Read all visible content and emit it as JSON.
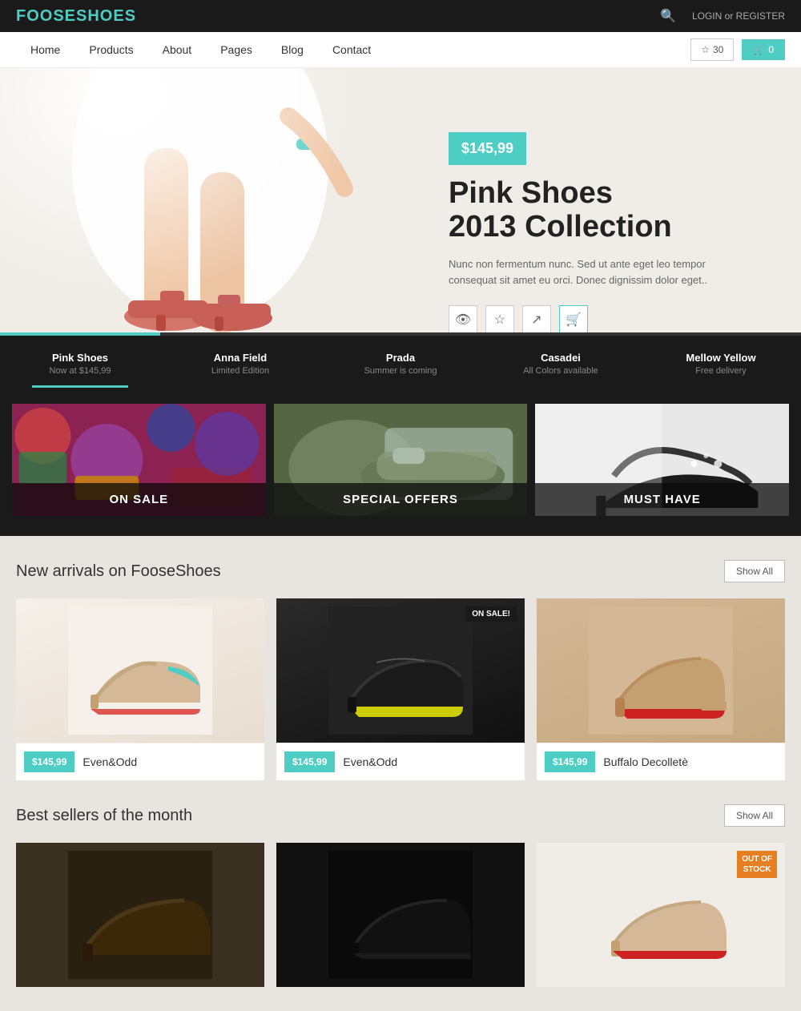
{
  "brand": {
    "name": "FOOSESHOES"
  },
  "topbar": {
    "search_icon": "🔍",
    "login_label": "LOGIN or REGISTER"
  },
  "nav": {
    "links": [
      {
        "label": "Home",
        "id": "home"
      },
      {
        "label": "Products",
        "id": "products"
      },
      {
        "label": "About",
        "id": "about"
      },
      {
        "label": "Pages",
        "id": "pages"
      },
      {
        "label": "Blog",
        "id": "blog"
      },
      {
        "label": "Contact",
        "id": "contact"
      }
    ],
    "wishlist_count": "30",
    "cart_count": "0"
  },
  "hero": {
    "price": "$145,99",
    "title_line1": "Pink Shoes",
    "title_line2": "2013 Collection",
    "description": "Nunc non fermentum nunc. Sed ut ante eget leo tempor consequat sit amet eu orci. Donec dignissim dolor eget.."
  },
  "slider": {
    "items": [
      {
        "name": "Pink Shoes",
        "sub": "Now at $145,99",
        "active": true
      },
      {
        "name": "Anna Field",
        "sub": "Limited Edition",
        "active": false
      },
      {
        "name": "Prada",
        "sub": "Summer is coming",
        "active": false
      },
      {
        "name": "Casadei",
        "sub": "All Colors available",
        "active": false
      },
      {
        "name": "Mellow Yellow",
        "sub": "Free delivery",
        "active": false
      }
    ]
  },
  "categories": [
    {
      "label": "ON SALE"
    },
    {
      "label": "SPECIAL OFFERS"
    },
    {
      "label": "MUST HAVE"
    }
  ],
  "new_arrivals": {
    "section_title": "New arrivals on FooseShoes",
    "show_all": "Show All",
    "products": [
      {
        "price": "$145,99",
        "name": "Even&Odd",
        "on_sale": false,
        "shoe_color": "beige"
      },
      {
        "price": "$145,99",
        "name": "Even&Odd",
        "on_sale": true,
        "sale_label": "ON SALE!",
        "shoe_color": "black"
      },
      {
        "price": "$145,99",
        "name": "Buffalo Decolletè",
        "on_sale": false,
        "shoe_color": "tan"
      }
    ]
  },
  "best_sellers": {
    "section_title": "Best sellers of the month",
    "show_all": "Show All",
    "products": [
      {
        "price": "",
        "name": "",
        "shoe_color": "dark",
        "out_of_stock": false
      },
      {
        "price": "",
        "name": "",
        "shoe_color": "black",
        "out_of_stock": false
      },
      {
        "price": "",
        "name": "",
        "shoe_color": "red",
        "out_of_stock": true,
        "out_label": "OUT OF\nSTOCK"
      }
    ]
  }
}
